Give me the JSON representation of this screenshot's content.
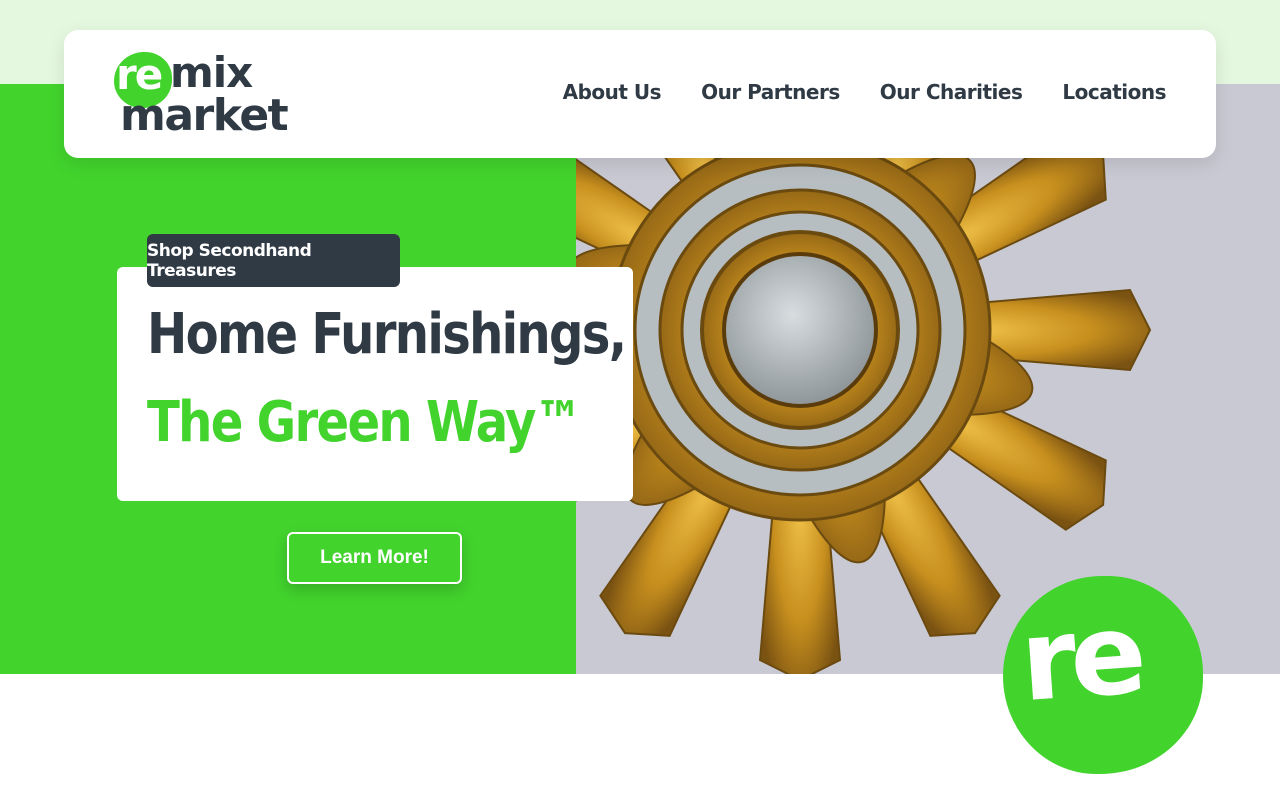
{
  "brand": {
    "logo_re": "re",
    "logo_mix": "mix",
    "logo_market": "market",
    "badge_text": "re",
    "colors": {
      "green": "#42d32d",
      "dark": "#2f3a45",
      "light_band": "#e4f7df",
      "white": "#ffffff"
    }
  },
  "nav": {
    "items": [
      {
        "label": "About Us"
      },
      {
        "label": "Our Partners"
      },
      {
        "label": "Our Charities"
      },
      {
        "label": "Locations"
      }
    ]
  },
  "hero": {
    "tag": "Shop Secondhand Treasures",
    "headline_1": "Home Furnishings,",
    "headline_2": "The Green Way™",
    "cta_label": "Learn More!",
    "image_subject": "gold-sunburst-mirror"
  }
}
